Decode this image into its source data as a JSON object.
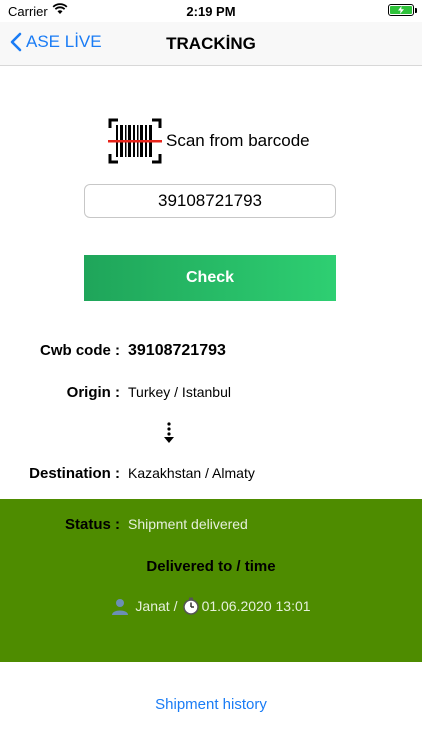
{
  "status_bar": {
    "carrier": "Carrier",
    "time": "2:19 PM"
  },
  "nav": {
    "back_label": "ASE LİVE",
    "title": "TRACKİNG"
  },
  "scan": {
    "label": "Scan from barcode"
  },
  "code_input": {
    "value": "39108721793"
  },
  "check_button": {
    "label": "Check"
  },
  "cwb": {
    "label": "Cwb code :",
    "value": "39108721793"
  },
  "origin": {
    "label": "Origin :",
    "value": "Turkey / Istanbul"
  },
  "destination": {
    "label": "Destination :",
    "value": "Kazakhstan / Almaty"
  },
  "status": {
    "label": "Status :",
    "value": "Shipment delivered",
    "panel_color": "#4e8c00"
  },
  "delivered": {
    "title": "Delivered to / time",
    "recipient": "Janat",
    "separator": "/",
    "time": "01.06.2020 13:01"
  },
  "history": {
    "label": "Shipment history"
  },
  "colors": {
    "accent": "#1a7cf5",
    "button": "#1fa55a",
    "battery": "#2fc23b"
  }
}
